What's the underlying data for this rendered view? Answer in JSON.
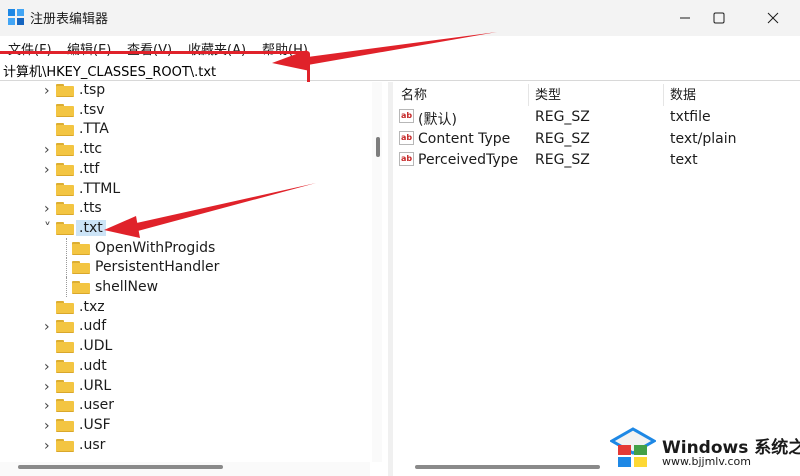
{
  "window": {
    "title": "注册表编辑器"
  },
  "menu": [
    "文件(F)",
    "编辑(E)",
    "查看(V)",
    "收藏夹(A)",
    "帮助(H)"
  ],
  "address": "计算机\\HKEY_CLASSES_ROOT\\.txt",
  "tree": [
    {
      "label": ".tsp",
      "expandable": true,
      "level": 0
    },
    {
      "label": ".tsv",
      "expandable": false,
      "level": 0
    },
    {
      "label": ".TTA",
      "expandable": false,
      "level": 0
    },
    {
      "label": ".ttc",
      "expandable": true,
      "level": 0
    },
    {
      "label": ".ttf",
      "expandable": true,
      "level": 0
    },
    {
      "label": ".TTML",
      "expandable": false,
      "level": 0
    },
    {
      "label": ".tts",
      "expandable": true,
      "level": 0
    },
    {
      "label": ".txt",
      "expandable": true,
      "expanded": true,
      "selected": true,
      "level": 0
    },
    {
      "label": "OpenWithProgids",
      "expandable": false,
      "level": 1
    },
    {
      "label": "PersistentHandler",
      "expandable": false,
      "level": 1
    },
    {
      "label": "shellNew",
      "expandable": false,
      "level": 1
    },
    {
      "label": ".txz",
      "expandable": false,
      "level": 0
    },
    {
      "label": ".udf",
      "expandable": true,
      "level": 0
    },
    {
      "label": ".UDL",
      "expandable": false,
      "level": 0
    },
    {
      "label": ".udt",
      "expandable": true,
      "level": 0
    },
    {
      "label": ".URL",
      "expandable": true,
      "level": 0
    },
    {
      "label": ".user",
      "expandable": true,
      "level": 0
    },
    {
      "label": ".USF",
      "expandable": true,
      "level": 0
    },
    {
      "label": ".usr",
      "expandable": true,
      "level": 0
    }
  ],
  "list": {
    "columns": [
      "名称",
      "类型",
      "数据"
    ],
    "rows": [
      {
        "name": "(默认)",
        "type": "REG_SZ",
        "data": "txtfile"
      },
      {
        "name": "Content Type",
        "type": "REG_SZ",
        "data": "text/plain"
      },
      {
        "name": "PerceivedType",
        "type": "REG_SZ",
        "data": "text"
      }
    ]
  },
  "icons": {
    "value": "ab"
  },
  "watermark": {
    "title": "Windows 系统之家",
    "subtitle": "www.bjjmlv.com"
  },
  "colors": {
    "annotation": "#e0222a",
    "folder": "#f3c542",
    "selection": "#cce4f7"
  }
}
